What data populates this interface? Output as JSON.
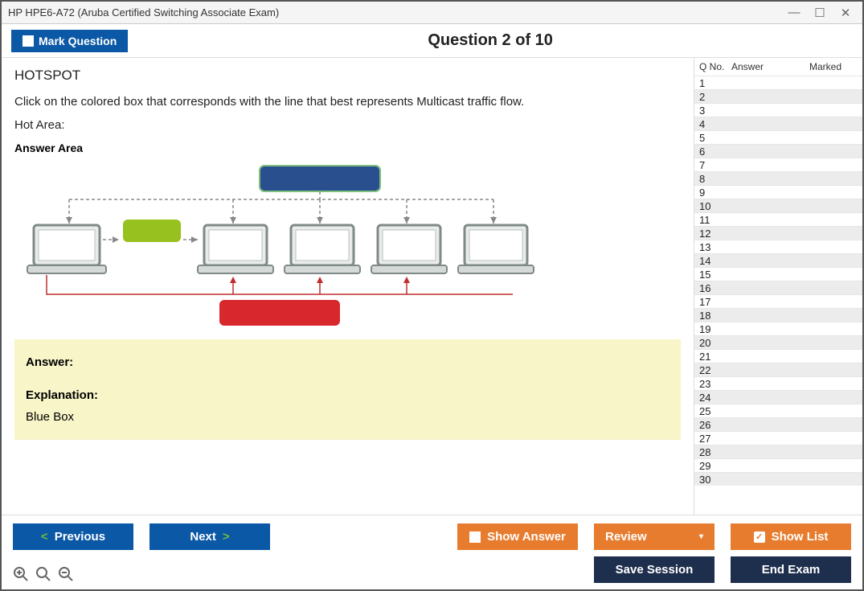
{
  "window": {
    "title": "HP HPE6-A72 (Aruba Certified Switching Associate Exam)"
  },
  "topbar": {
    "mark_label": "Mark Question",
    "question_header": "Question 2 of 10"
  },
  "question": {
    "type": "HOTSPOT",
    "text": "Click on the colored box that corresponds with the line that best represents Multicast traffic flow.",
    "hot_area_label": "Hot Area:",
    "answer_area_label": "Answer Area"
  },
  "answer_panel": {
    "answer_label": "Answer:",
    "explanation_label": "Explanation:",
    "explanation_text": "Blue Box"
  },
  "side": {
    "col_qno": "Q No.",
    "col_answer": "Answer",
    "col_marked": "Marked",
    "rows": [
      "1",
      "2",
      "3",
      "4",
      "5",
      "6",
      "7",
      "8",
      "9",
      "10",
      "11",
      "12",
      "13",
      "14",
      "15",
      "16",
      "17",
      "18",
      "19",
      "20",
      "21",
      "22",
      "23",
      "24",
      "25",
      "26",
      "27",
      "28",
      "29",
      "30"
    ]
  },
  "footer": {
    "previous": "Previous",
    "next": "Next",
    "show_answer": "Show Answer",
    "review": "Review",
    "show_list": "Show List",
    "save_session": "Save Session",
    "end_exam": "End Exam"
  }
}
